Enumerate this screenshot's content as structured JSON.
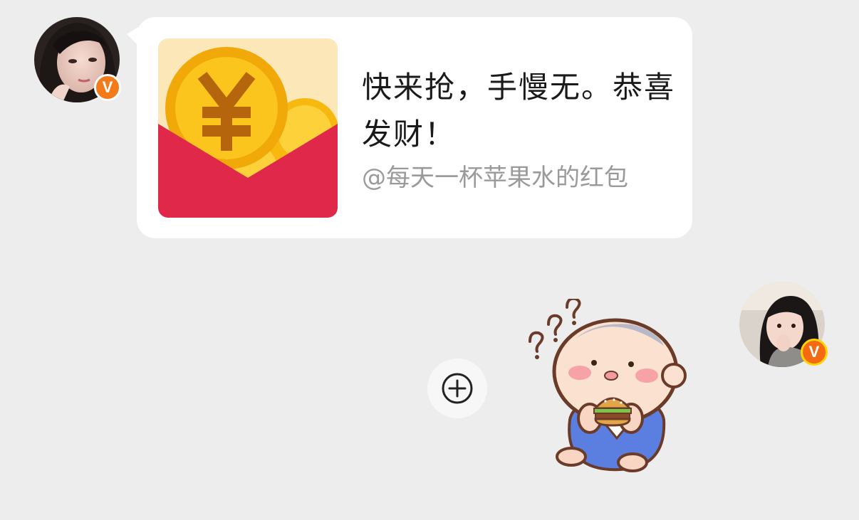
{
  "messages": [
    {
      "sender": "other",
      "type": "red_packet",
      "avatar_badge": "V",
      "red_packet": {
        "title": "快来抢，手慢无。恭喜发财！",
        "sender_label": "@每天一杯苹果水的红包",
        "icon": "red-envelope-icon"
      }
    },
    {
      "sender": "self",
      "type": "sticker",
      "avatar_badge": "V",
      "sticker": "confused-baby-eating-burger"
    }
  ],
  "actions": {
    "add_icon": "plus-circle-icon"
  },
  "colors": {
    "background": "#ededed",
    "bubble": "#ffffff",
    "packet_red": "#e0294a",
    "coin_gold": "#f7b90f",
    "badge_orange": "#f47a1a",
    "sub_text": "#9a9a9a"
  }
}
